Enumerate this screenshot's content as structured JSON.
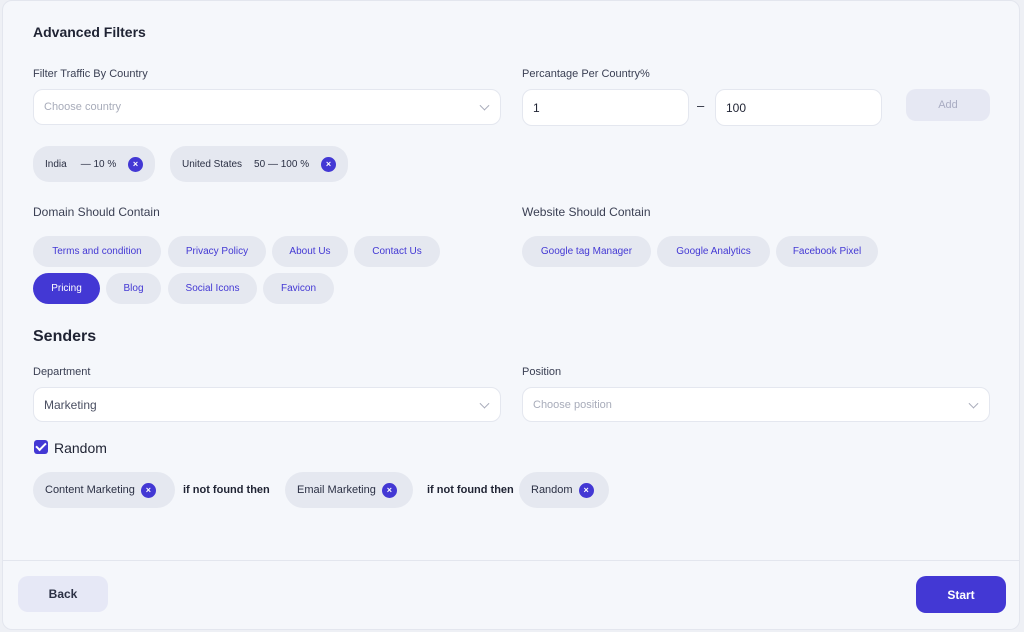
{
  "advanced": {
    "title": "Advanced Filters",
    "country_label": "Filter Traffic By Country",
    "country_placeholder": "Choose country",
    "percent_label": "Percantage Per Country%",
    "percent_min": "1",
    "percent_sep": "–",
    "percent_max": "100",
    "add_label": "Add",
    "country_tags": [
      {
        "name": "India",
        "range": "— 10 %"
      },
      {
        "name": "United States",
        "range": "50 — 100 %"
      }
    ],
    "remove_symbol": "×"
  },
  "domain": {
    "label": "Domain Should Contain",
    "pills": [
      "Terms and condition",
      "Privacy Policy",
      "About Us",
      "Contact Us",
      "Pricing",
      "Blog",
      "Social Icons",
      "Favicon"
    ],
    "active": "Pricing"
  },
  "website": {
    "label": "Website Should Contain",
    "pills": [
      "Google tag Manager",
      "Google Analytics",
      "Facebook Pixel"
    ]
  },
  "senders": {
    "title": "Senders",
    "department_label": "Department",
    "department_value": "Marketing",
    "position_label": "Position",
    "position_placeholder": "Choose position",
    "random_label": "Random",
    "random_checked": true,
    "chain": [
      "Content Marketing",
      "Email Marketing",
      "Random"
    ],
    "connector": "if not found then"
  },
  "footer": {
    "back_label": "Back",
    "start_label": "Start"
  },
  "colors": {
    "accent": "#4338d4",
    "pill_bg": "#e5e8f0",
    "panel_bg": "#f5f7fb"
  }
}
